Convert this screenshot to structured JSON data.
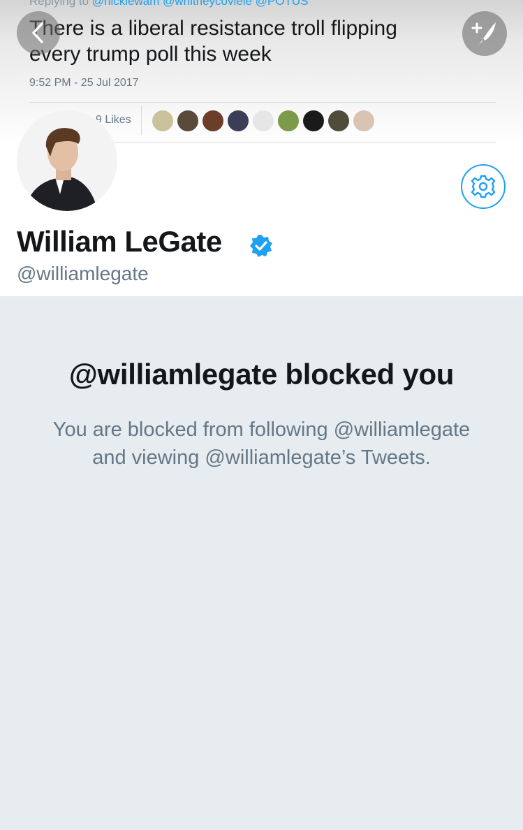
{
  "tweet": {
    "replying_prefix": "Replying to",
    "replying_handles": "@nickiewam @whitneycoviele @POTUS",
    "text": "There is a liberal resistance troll flipping every trump poll this week",
    "timestamp": "9:52 PM - 25 Jul 2017",
    "likes_label": "9 Likes",
    "liker_colors": [
      "#c9c29a",
      "#5a4a3a",
      "#6b3e2a",
      "#3a3f55",
      "#e6e6e6",
      "#7c9b4a",
      "#1a1a1a",
      "#4d4d3a",
      "#d8c4b0"
    ]
  },
  "nav": {
    "back_icon": "chevron-left-icon",
    "compose_icon": "compose-tweet-icon"
  },
  "profile": {
    "display_name": "William LeGate",
    "verified": true,
    "screen_name": "@williamlegate",
    "settings_icon": "gear-icon"
  },
  "blocked": {
    "title": "@williamlegate blocked you",
    "message": "You are blocked from following @williamlegate and viewing @williamlegate’s Tweets."
  },
  "colors": {
    "accent": "#1da1f2",
    "background": "#e6ecf0",
    "text_primary": "#14171a",
    "text_secondary": "#657786"
  }
}
